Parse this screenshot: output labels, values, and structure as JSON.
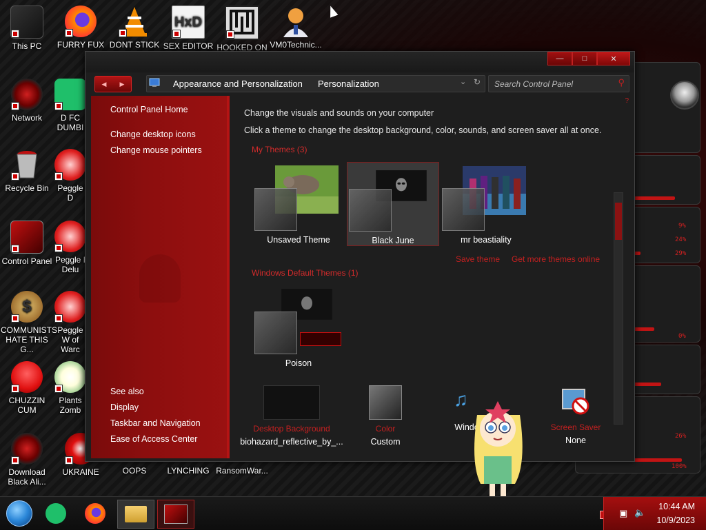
{
  "desktop_icons": [
    {
      "label": "This PC"
    },
    {
      "label": "FURRY FUX"
    },
    {
      "label": "DONT STICK"
    },
    {
      "label": "SEX EDITOR"
    },
    {
      "label": "HOOKED ON"
    },
    {
      "label": "VM0Technic..."
    },
    {
      "label": "Network"
    },
    {
      "label": "D FC DUMBI"
    },
    {
      "label": "Recycle Bin"
    },
    {
      "label": "Peggle D"
    },
    {
      "label": "Control Panel"
    },
    {
      "label": "Peggle I Delu"
    },
    {
      "label": "COMMUNISTS HATE THIS G..."
    },
    {
      "label": "Peggle W of Warc"
    },
    {
      "label": "CHUZZIN CUM"
    },
    {
      "label": "Plants Zomb"
    },
    {
      "label": "Download Black Ali..."
    },
    {
      "label": "UKRAINE"
    },
    {
      "label": "OOPS"
    },
    {
      "label": "LYNCHING"
    },
    {
      "label": "RansomWar..."
    }
  ],
  "window": {
    "address": {
      "crumb1": "Appearance and Personalization",
      "crumb2": "Personalization"
    },
    "search_placeholder": "Search Control Panel",
    "sidebar": {
      "home": "Control Panel Home",
      "links": [
        "Change desktop icons",
        "Change mouse pointers"
      ],
      "see_also_title": "See also",
      "see_also": [
        "Display",
        "Taskbar and Navigation",
        "Ease of Access Center"
      ]
    },
    "content": {
      "heading": "Change the visuals and sounds on your computer",
      "subheading": "Click a theme to change the desktop background, color, sounds, and screen saver all at once.",
      "my_themes_title": "My Themes (3)",
      "my_themes": [
        {
          "name": "Unsaved Theme"
        },
        {
          "name": "Black June",
          "selected": true
        },
        {
          "name": "mr beastiality"
        }
      ],
      "save_theme": "Save theme",
      "get_more": "Get more themes online",
      "default_themes_title": "Windows Default Themes (1)",
      "default_themes": [
        {
          "name": "Poison"
        }
      ],
      "bottom": [
        {
          "label": "Desktop Background",
          "value": "biohazard_reflective_by_..."
        },
        {
          "label": "Color",
          "value": "Custom"
        },
        {
          "label": "",
          "value": "Windo"
        },
        {
          "label": "Screen Saver",
          "value": "None"
        }
      ]
    }
  },
  "taskbar": {
    "time": "10:44 AM",
    "date": "10/9/2023"
  },
  "hud": {
    "percents": [
      "9%",
      "24%",
      "29%",
      "0%",
      "26%",
      "100%"
    ]
  },
  "colors": {
    "accent_red": "#c42020",
    "sidebar_red": "#8c0e0e",
    "window_bg": "#1e1e1e"
  }
}
